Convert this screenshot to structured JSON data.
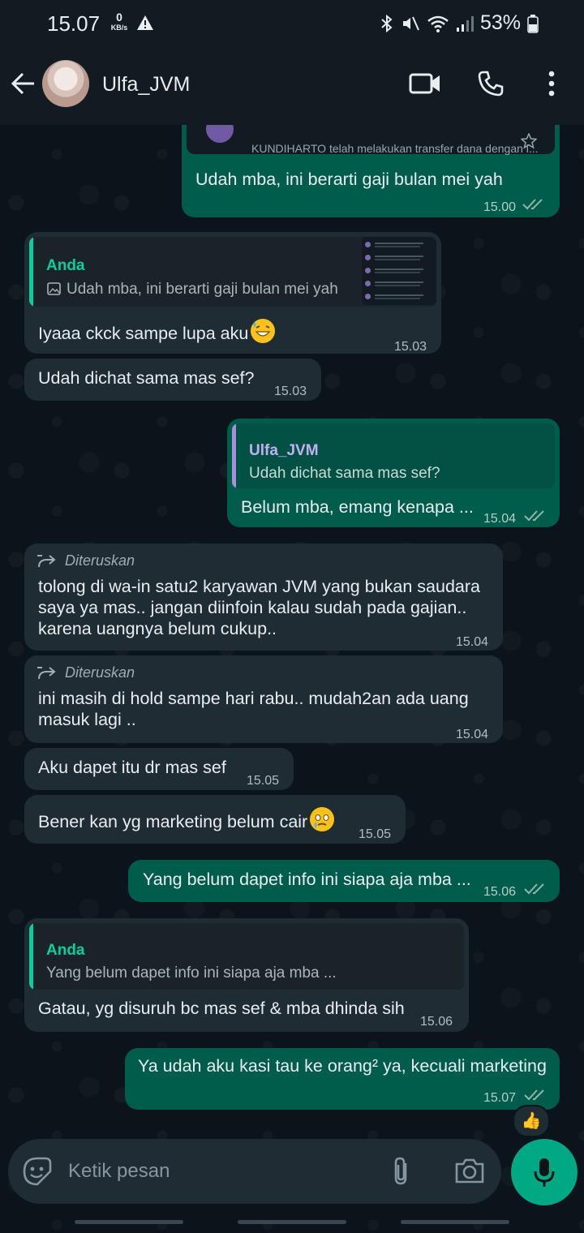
{
  "status_bar": {
    "time": "15.07",
    "net_speed_value": "0",
    "net_speed_unit": "KB/s",
    "battery": "53%"
  },
  "header": {
    "contact_name": "Ulfa_JVM"
  },
  "messages": [
    {
      "preview_text": "KUNDIHARTO telah melakukan transfer dana dengan i...",
      "text": "Udah mba, ini berarti gaji bulan mei yah",
      "time": "15.00"
    },
    {
      "quote_name": "Anda",
      "quote_text": "Udah mba, ini berarti gaji bulan mei yah",
      "text": "Iyaaa ckck sampe lupa aku",
      "time": "15.03"
    },
    {
      "text": "Udah dichat sama mas sef?",
      "time": "15.03"
    },
    {
      "quote_name": "Ulfa_JVM",
      "quote_text": "Udah dichat sama mas sef?",
      "text": "Belum mba, emang kenapa ...",
      "time": "15.04"
    },
    {
      "forwarded_label": "Diteruskan",
      "lines": [
        "tolong di wa-in satu2 karyawan JVM yang bukan saudara",
        "saya ya mas.. jangan diinfoin kalau sudah pada gajian..",
        "karena uangnya belum cukup.."
      ],
      "time": "15.04"
    },
    {
      "forwarded_label": "Diteruskan",
      "lines": [
        "ini masih di hold sampe hari rabu.. mudah2an ada uang",
        "masuk lagi .."
      ],
      "time": "15.04"
    },
    {
      "text": "Aku dapet itu dr mas sef",
      "time": "15.05"
    },
    {
      "text": "Bener kan yg marketing belum cair",
      "time": "15.05"
    },
    {
      "text": "Yang belum dapet info ini siapa aja mba ...",
      "time": "15.06"
    },
    {
      "quote_name": "Anda",
      "quote_text": "Yang belum dapet info ini siapa aja mba ...",
      "text": "Gatau, yg disuruh bc mas sef & mba dhinda sih",
      "time": "15.06"
    },
    {
      "text": "Ya udah aku kasi tau ke orang² ya, kecuali marketing",
      "time": "15.07"
    }
  ],
  "reaction": "👍",
  "composer": {
    "placeholder": "Ketik pesan"
  },
  "colors": {
    "incoming": "#202c33",
    "outgoing": "#005c4b",
    "accent": "#00a884",
    "quote_you": "#06cf9c",
    "quote_contact": "#a791d8"
  }
}
